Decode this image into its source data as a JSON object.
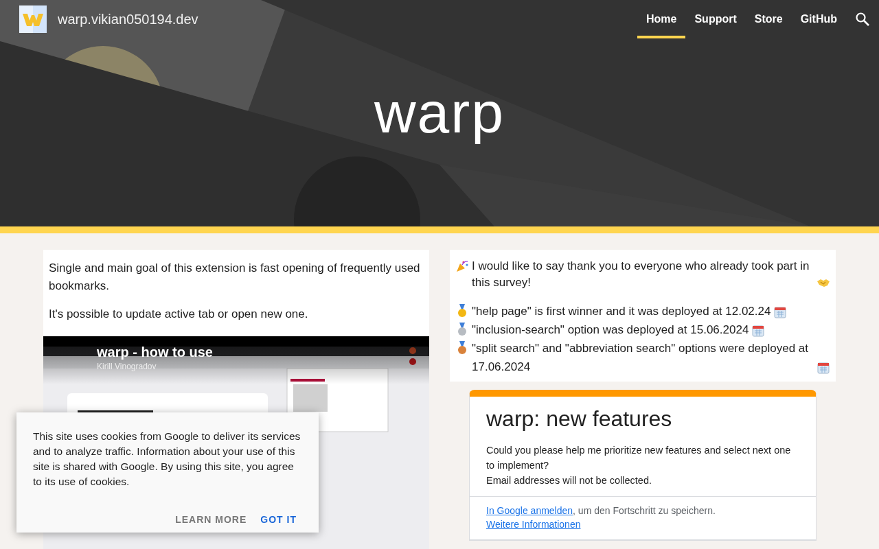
{
  "site": {
    "title": "warp.vikian050194.dev"
  },
  "nav": [
    {
      "label": "Home",
      "selected": true
    },
    {
      "label": "Support",
      "selected": false
    },
    {
      "label": "Store",
      "selected": false
    },
    {
      "label": "GitHub",
      "selected": false
    }
  ],
  "hero": {
    "title": "warp"
  },
  "intro": {
    "paragraphs": [
      "Single and main goal of this extension is fast opening of frequently used bookmarks.",
      "It's possible to update active tab or open new one."
    ]
  },
  "video": {
    "title": "warp - how to use",
    "author": "Kirill Vinogradov"
  },
  "news": {
    "thanks": "I would like to say thank you to everyone who already took part in this survey!",
    "items": [
      {
        "color": "#f2b713",
        "text": " \"help page\" is first winner and it was deployed at 12.02.24"
      },
      {
        "color": "#b7bcc2",
        "text": "\"inclusion-search\" option was deployed at 15.06.2024"
      },
      {
        "color": "#d9823b",
        "text": "\"split search\" and \"abbreviation search\" options  were deployed at 17.06.2024"
      }
    ]
  },
  "form": {
    "title": "warp: new features",
    "description": [
      "Could you please help me prioritize new features and select next one to implement?",
      "Email addresses will not be collected."
    ],
    "signin_link": "In Google anmelden",
    "signin_rest": ", um den Fortschritt zu speichern.",
    "more_link": "Weitere Informationen"
  },
  "cookie": {
    "text": "This site uses cookies from Google to deliver its services and to analyze traffic. Information about your use of this site is shared with Google. By using this site, you agree to its use of cookies.",
    "buttons": [
      {
        "label": "LEARN MORE",
        "kind": "secondary"
      },
      {
        "label": "GOT IT",
        "kind": "primary"
      }
    ]
  }
}
